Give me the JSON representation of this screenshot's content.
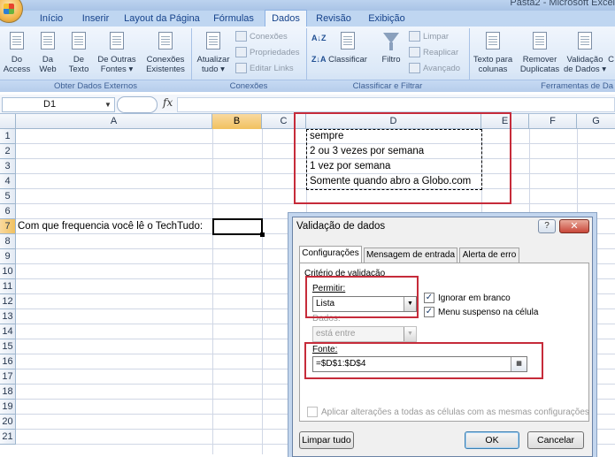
{
  "window": {
    "title": "Pasta2 - Microsoft Excel"
  },
  "tabs": [
    {
      "label": "Início",
      "active": false
    },
    {
      "label": "Inserir",
      "active": false
    },
    {
      "label": "Layout da Página",
      "active": false
    },
    {
      "label": "Fórmulas",
      "active": false
    },
    {
      "label": "Dados",
      "active": true
    },
    {
      "label": "Revisão",
      "active": false
    },
    {
      "label": "Exibição",
      "active": false
    }
  ],
  "ribbon": {
    "external": {
      "label": "Obter Dados Externos",
      "buttons": [
        {
          "line1": "Do",
          "line2": "Access"
        },
        {
          "line1": "Da",
          "line2": "Web"
        },
        {
          "line1": "De",
          "line2": "Texto"
        },
        {
          "line1": "De Outras",
          "line2": "Fontes ▾"
        },
        {
          "line1": "Conexões",
          "line2": "Existentes"
        }
      ]
    },
    "connections": {
      "label": "Conexões",
      "refresh": {
        "line1": "Atualizar",
        "line2": "tudo ▾"
      },
      "small": [
        "Conexões",
        "Propriedades",
        "Editar Links"
      ]
    },
    "sort_filter": {
      "label": "Classificar e Filtrar",
      "sort_az": "A↓Z",
      "sort_za": "Z↓A",
      "sort": "Classificar",
      "filter": "Filtro",
      "small": [
        "Limpar",
        "Reaplicar",
        "Avançado"
      ]
    },
    "tools": {
      "label": "Ferramentas de Da",
      "buttons": [
        {
          "line1": "Texto para",
          "line2": "colunas"
        },
        {
          "line1": "Remover",
          "line2": "Duplicatas"
        },
        {
          "line1": "Validação",
          "line2": "de Dados ▾"
        },
        {
          "line1": "C",
          "line2": ""
        }
      ]
    }
  },
  "formula_bar": {
    "name_box": "D1",
    "fx": "fx",
    "formula": ""
  },
  "grid": {
    "columns": [
      "A",
      "B",
      "C",
      "D",
      "E",
      "F",
      "G"
    ],
    "selected_column": "B",
    "rows": [
      "1",
      "2",
      "3",
      "4",
      "5",
      "6",
      "7",
      "8",
      "9",
      "10",
      "11",
      "12",
      "13",
      "14",
      "15",
      "16",
      "17",
      "18",
      "19",
      "20",
      "21"
    ],
    "selected_row": "7",
    "cells": {
      "D1": "sempre",
      "D2": "2 ou 3 vezes por semana",
      "D3": "1 vez por semana",
      "D4": "Somente quando abro a Globo.com",
      "A7": "Com que frequencia você lê o TechTudo:"
    }
  },
  "dialog": {
    "title": "Validação de dados",
    "help": "?",
    "close": "✕",
    "tabs": [
      "Configurações",
      "Mensagem de entrada",
      "Alerta de erro"
    ],
    "criteria_label": "Critério de validação",
    "allow_label": "Permitir:",
    "allow_value": "Lista",
    "ignore_blank": {
      "label": "Ignorar em branco",
      "checked": true
    },
    "dropdown_menu": {
      "label": "Menu suspenso na célula",
      "checked": true
    },
    "data_label": "Dados:",
    "data_value": "está entre",
    "source_label": "Fonte:",
    "source_value": "=$D$1:$D$4",
    "apply_all": {
      "label": "Aplicar alterações a todas as células com as mesmas configurações",
      "checked": false
    },
    "clear_button": "Limpar tudo",
    "ok_button": "OK",
    "cancel_button": "Cancelar"
  },
  "colors": {
    "highlight": "#c62b3a",
    "ribbon": "#dbe8f7",
    "selected_header": "#f1c15f"
  }
}
